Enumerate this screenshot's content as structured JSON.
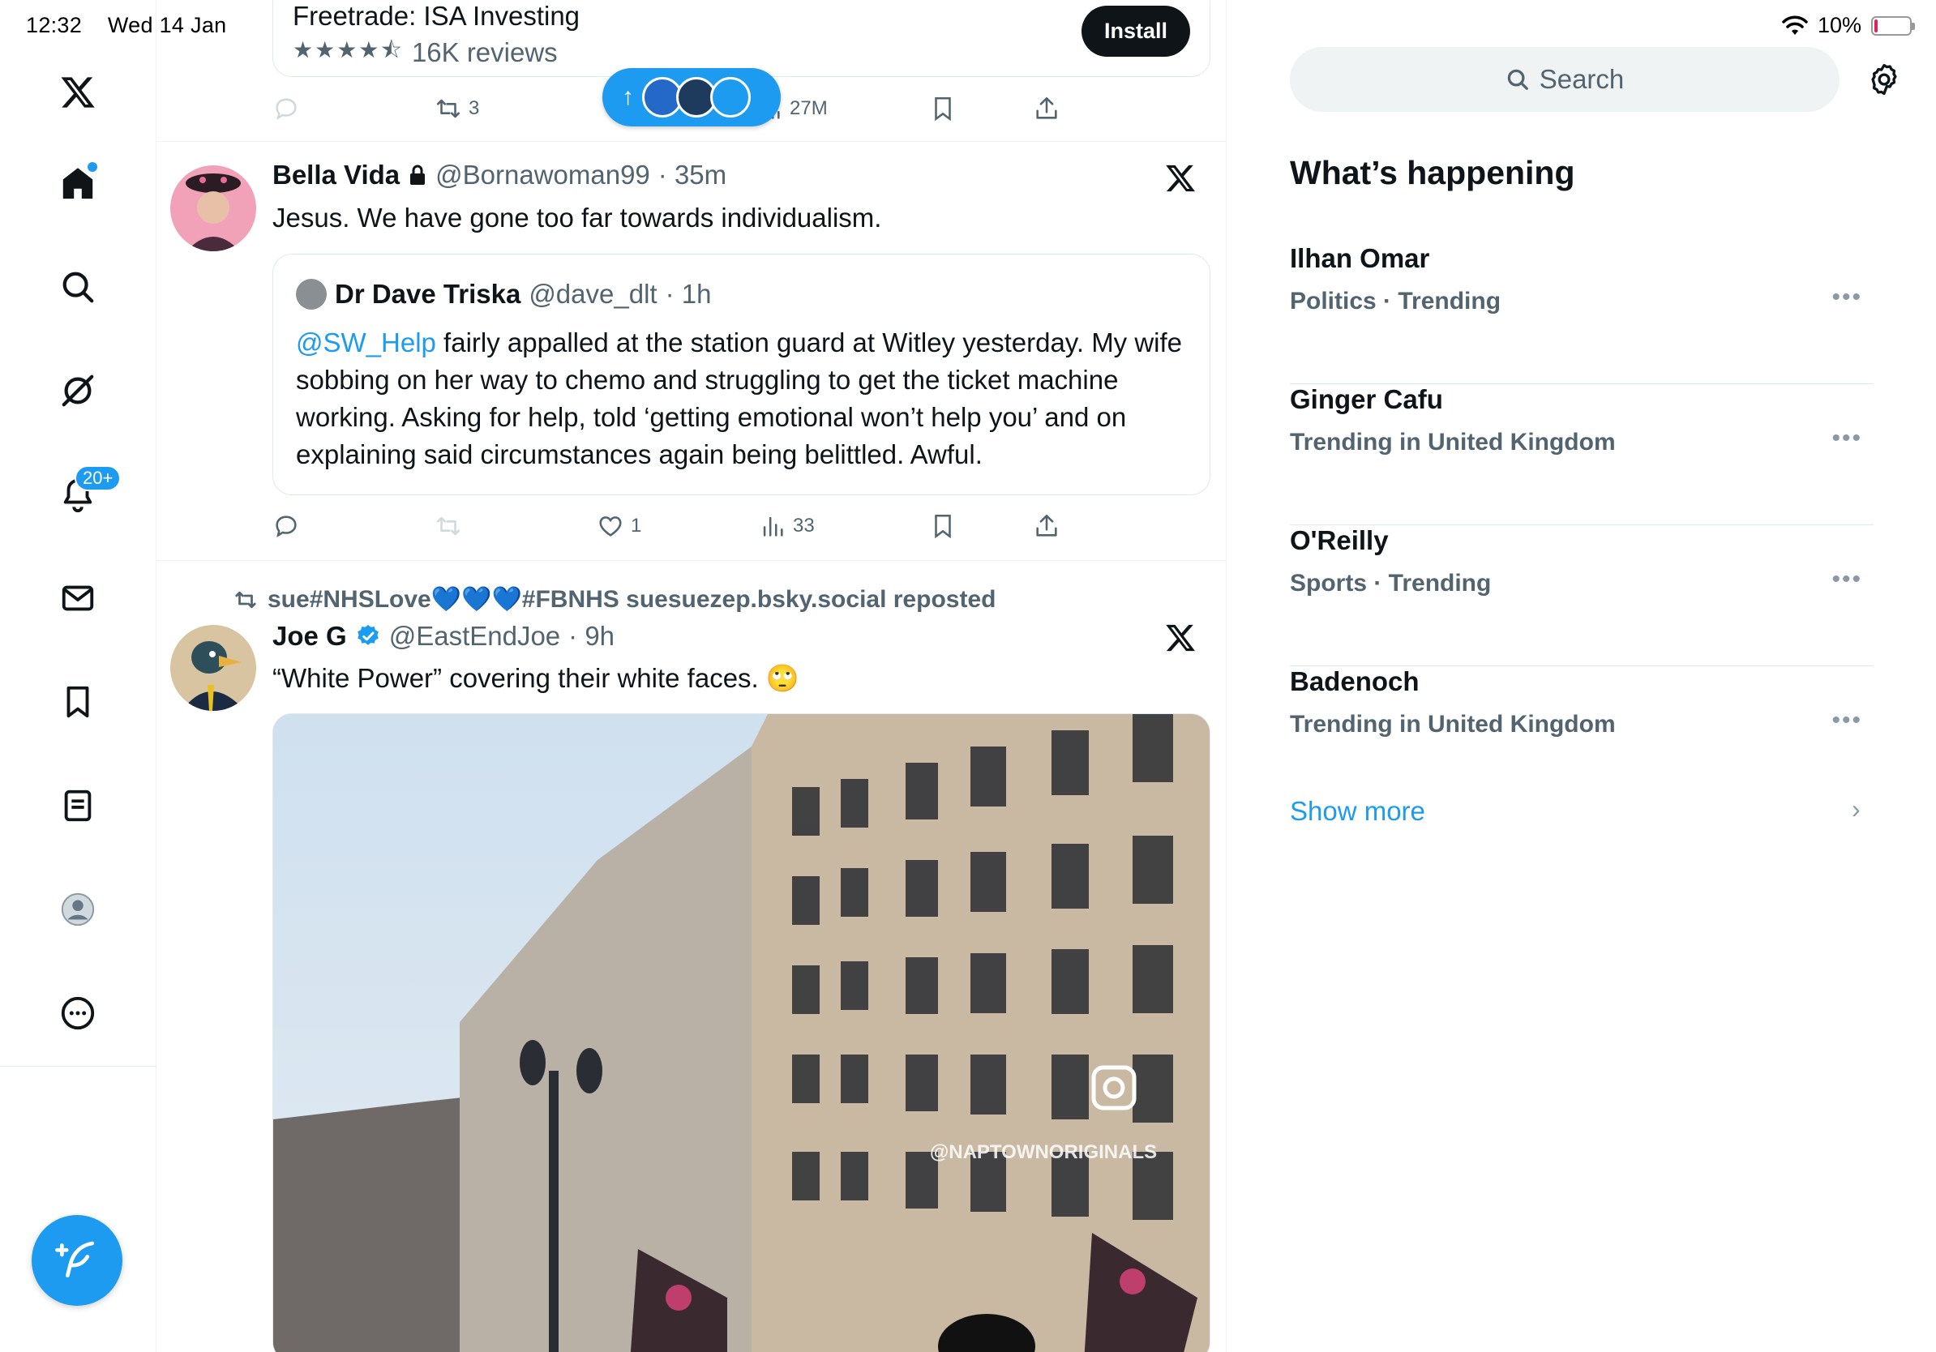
{
  "status_bar": {
    "time": "12:32",
    "date": "Wed 14 Jan",
    "battery_text": "10%",
    "battery_level": 0.1
  },
  "colors": {
    "accent": "#1d9bf0",
    "text": "#0f1419",
    "secondary": "#536471",
    "border": "#eff3f4"
  },
  "nav": {
    "items": [
      {
        "icon": "x-logo-icon"
      },
      {
        "icon": "home-icon"
      },
      {
        "icon": "search-icon"
      },
      {
        "icon": "grok-icon"
      },
      {
        "icon": "notifications-icon"
      },
      {
        "icon": "messages-icon"
      },
      {
        "icon": "bookmarks-icon"
      },
      {
        "icon": "lists-icon"
      },
      {
        "icon": "profile-icon"
      },
      {
        "icon": "more-icon"
      }
    ],
    "notifications_badge": "20+"
  },
  "ad": {
    "title": "Freetrade: ISA Investing",
    "stars": "★★★★⯪",
    "reviews": "16K reviews",
    "install_label": "Install",
    "retweets": "3",
    "views": "27M"
  },
  "tweets": [
    {
      "name": "Bella Vida",
      "handle": "@Bornawoman99",
      "time": "· 35m",
      "text": "Jesus. We have gone too far towards individualism.",
      "quote": {
        "name": "Dr Dave Triska",
        "handle": "@dave_dlt",
        "time": "· 1h",
        "mention": "@SW_Help",
        "text": " fairly appalled at the station guard at Witley yesterday. My wife sobbing on her way to chemo and struggling to get the ticket machine working. Asking for help, told ‘getting emotional won’t help you’ and on explaining said circumstances again being  belittled. Awful."
      },
      "likes": "1",
      "views": "33"
    },
    {
      "repost_by": "sue#NHSLove💙💙💙#FBNHS suesuezep.bsky.social reposted",
      "name": "Joe G",
      "handle": "@EastEndJoe",
      "time": "· 9h",
      "text": "“White Power” covering their white faces. 🙄",
      "watermark": "@NAPTOWNORIGINALS"
    }
  ],
  "sidebar": {
    "search_placeholder": "Search",
    "heading": "What’s happening",
    "trends": [
      {
        "title": "Ilhan Omar",
        "meta": "Politics · Trending"
      },
      {
        "title": "Ginger Cafu",
        "meta": "Trending in United Kingdom"
      },
      {
        "title": "O'Reilly",
        "meta": "Sports · Trending"
      },
      {
        "title": "Badenoch",
        "meta": "Trending in United Kingdom"
      }
    ],
    "show_more": "Show more"
  }
}
